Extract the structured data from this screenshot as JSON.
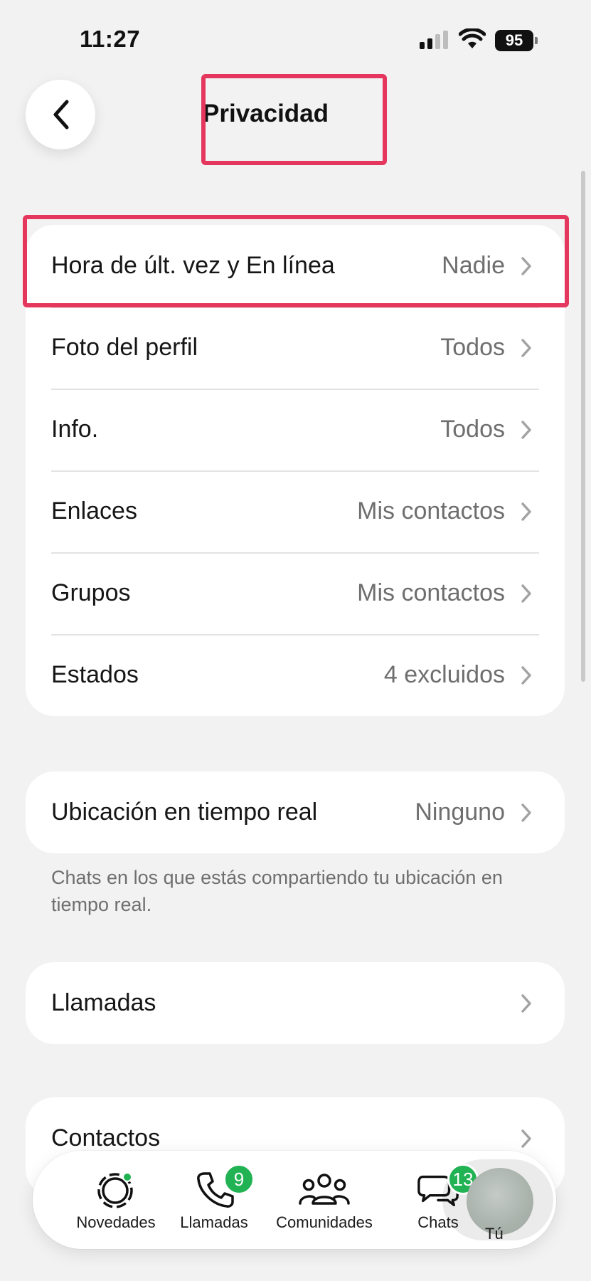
{
  "status_bar": {
    "time": "11:27",
    "battery": "95"
  },
  "header": {
    "title": "Privacidad",
    "back_icon": "chevron-left-icon"
  },
  "privacy_items": [
    {
      "label": "Hora de últ. vez y En línea",
      "value": "Nadie"
    },
    {
      "label": "Foto del perfil",
      "value": "Todos"
    },
    {
      "label": "Info.",
      "value": "Todos"
    },
    {
      "label": "Enlaces",
      "value": "Mis contactos"
    },
    {
      "label": "Grupos",
      "value": "Mis contactos"
    },
    {
      "label": "Estados",
      "value": "4 excluidos"
    }
  ],
  "live_location": {
    "label": "Ubicación en tiempo real",
    "value": "Ninguno",
    "footnote": "Chats en los que estás compartiendo tu ubicación en tiempo real."
  },
  "calls": {
    "label": "Llamadas"
  },
  "contacts": {
    "label": "Contactos"
  },
  "tab_bar": {
    "novedades": {
      "label": "Novedades",
      "has_dot": true,
      "dot_color": "#21b253"
    },
    "llamadas": {
      "label": "Llamadas",
      "badge": "9"
    },
    "comunidades": {
      "label": "Comunidades"
    },
    "chats": {
      "label": "Chats",
      "badge": "13"
    },
    "tu": {
      "label": "Tú",
      "selected": true
    }
  },
  "colors": {
    "accent": "#21b253",
    "highlight": "#e5375d",
    "background": "#f2f2f2"
  }
}
